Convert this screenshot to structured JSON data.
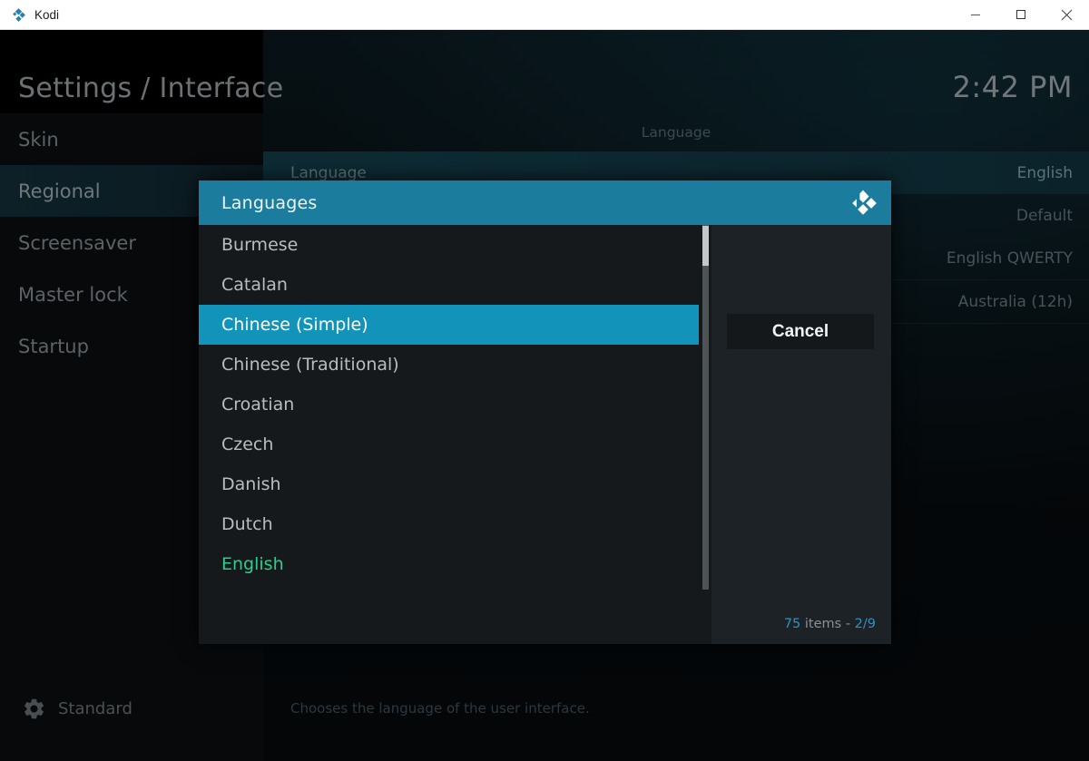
{
  "window": {
    "app_title": "Kodi",
    "logo_icon": "kodi-logo-icon",
    "controls": {
      "minimize": "minimize-icon",
      "maximize": "maximize-icon",
      "close": "close-icon"
    }
  },
  "header": {
    "page_title": "Settings / Interface",
    "clock": "2:42 PM"
  },
  "sidebar": {
    "items": [
      {
        "label": "Skin",
        "selected": false
      },
      {
        "label": "Regional",
        "selected": true
      },
      {
        "label": "Screensaver",
        "selected": false
      },
      {
        "label": "Master lock",
        "selected": false
      },
      {
        "label": "Startup",
        "selected": false
      }
    ],
    "level": {
      "icon": "gear-icon",
      "label": "Standard"
    }
  },
  "settings": {
    "group_title": "Language",
    "rows": [
      {
        "label": "Language",
        "value": "English",
        "highlighted": true
      },
      {
        "label": "",
        "value": "Default",
        "highlighted": false
      },
      {
        "label": "",
        "value": "English QWERTY",
        "highlighted": false
      },
      {
        "label": "",
        "value": "",
        "highlighted": false
      },
      {
        "label": "",
        "value": "Australia (12h)",
        "highlighted": false
      }
    ],
    "description": "Chooses the language of the user interface."
  },
  "dialog": {
    "title": "Languages",
    "logo_icon": "kodi-logo-icon",
    "cancel_label": "Cancel",
    "item_count": {
      "total": "75",
      "word": "items -",
      "page": "2/9"
    },
    "languages": [
      {
        "label": "Burmese",
        "state": "normal"
      },
      {
        "label": "Catalan",
        "state": "normal"
      },
      {
        "label": "Chinese (Simple)",
        "state": "active"
      },
      {
        "label": "Chinese (Traditional)",
        "state": "normal"
      },
      {
        "label": "Croatian",
        "state": "normal"
      },
      {
        "label": "Czech",
        "state": "normal"
      },
      {
        "label": "Danish",
        "state": "normal"
      },
      {
        "label": "Dutch",
        "state": "normal"
      },
      {
        "label": "English",
        "state": "current"
      }
    ],
    "scrollbar": {
      "thumb_top_pct": 11,
      "thumb_height_pct": 11
    }
  },
  "colors": {
    "accent_teal": "#1193ba",
    "header_teal": "#1b7c9e",
    "current_green": "#2ecc8f",
    "dialog_body": "#191e21",
    "list_panel": "#15191b"
  }
}
